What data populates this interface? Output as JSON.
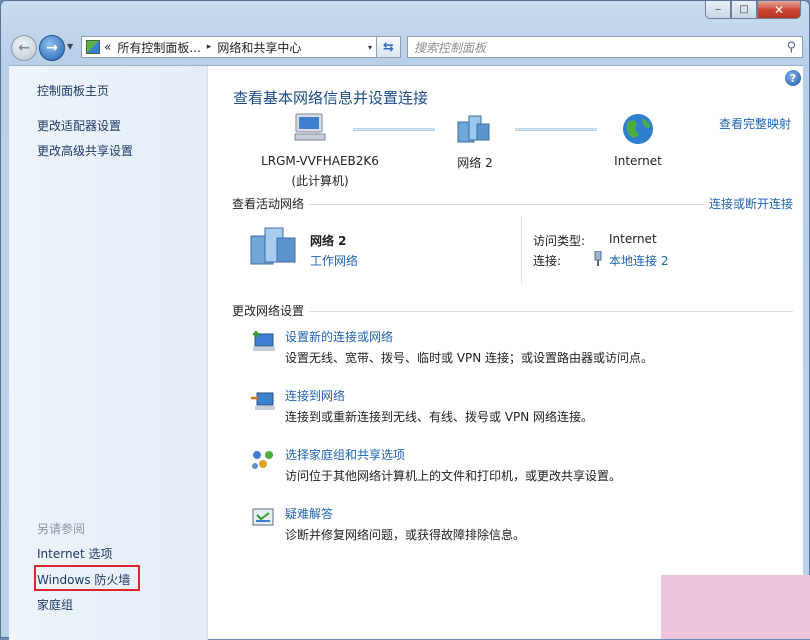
{
  "window": {
    "caption": {
      "minimize": "‒",
      "maximize": "□",
      "close": "✕"
    }
  },
  "address": {
    "history_chevron": "«",
    "crumb_root": "所有控制面板...",
    "crumb_current": "网络和共享中心",
    "separator": "▸",
    "dropdown": "▾"
  },
  "search": {
    "placeholder": "搜索控制面板",
    "icon": "search-icon"
  },
  "sidebar": {
    "items": [
      {
        "label": "控制面板主页"
      },
      {
        "label": "更改适配器设置"
      },
      {
        "label": "更改高级共享设置"
      }
    ],
    "see_also_heading": "另请参阅",
    "see_also": [
      {
        "label": "Internet 选项"
      },
      {
        "label": "Windows 防火墙"
      },
      {
        "label": "家庭组"
      }
    ],
    "highlight_color": "#d9262b"
  },
  "main": {
    "title": "查看基本网络信息并设置连接",
    "see_full_map": "查看完整映射",
    "map": {
      "computer_name": "LRGM-VVFHAEB2K6",
      "computer_sub": "(此计算机)",
      "network": "网络  2",
      "internet": "Internet"
    },
    "active_section": "查看活动网络",
    "connect_disconnect": "连接或断开连接",
    "active": {
      "name": "网络  2",
      "type_link": "工作网络",
      "access_label": "访问类型:",
      "access_value": "Internet",
      "conn_label": "连接:",
      "conn_value": "本地连接 2"
    },
    "change_section": "更改网络设置",
    "tasks": [
      {
        "title": "设置新的连接或网络",
        "desc": "设置无线、宽带、拨号、临时或 VPN 连接；或设置路由器或访问点。"
      },
      {
        "title": "连接到网络",
        "desc": "连接到或重新连接到无线、有线、拨号或 VPN 网络连接。"
      },
      {
        "title": "选择家庭组和共享选项",
        "desc": "访问位于其他网络计算机上的文件和打印机，或更改共享设置。"
      },
      {
        "title": "疑难解答",
        "desc": "诊断并修复网络问题，或获得故障排除信息。"
      }
    ],
    "help": "?"
  }
}
